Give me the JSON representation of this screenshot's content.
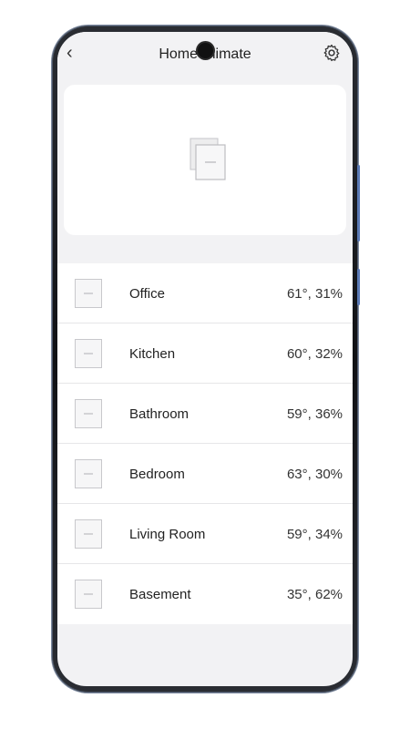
{
  "header": {
    "back_symbol": "‹",
    "title": "Home Climate",
    "settings_icon": "gear-icon"
  },
  "hero": {
    "icon": "device-thumbnail-icon"
  },
  "rooms": [
    {
      "name": "Office",
      "reading": "61°, 31%"
    },
    {
      "name": "Kitchen",
      "reading": "60°, 32%"
    },
    {
      "name": "Bathroom",
      "reading": "59°, 36%"
    },
    {
      "name": "Bedroom",
      "reading": "63°, 30%"
    },
    {
      "name": "Living Room",
      "reading": "59°, 34%"
    },
    {
      "name": "Basement",
      "reading": "35°, 62%"
    }
  ]
}
